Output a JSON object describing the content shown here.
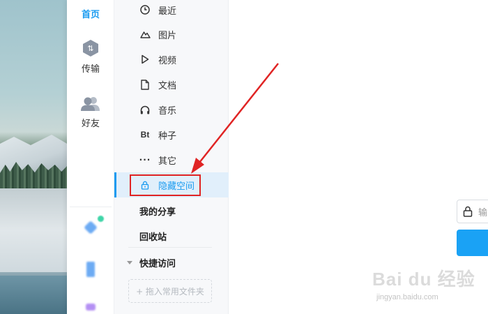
{
  "nav": {
    "home_label": "首页",
    "transfer_label": "传输",
    "friends_label": "好友",
    "transfer_icon_text": "⇅"
  },
  "categories": {
    "items": [
      {
        "label": "最近",
        "icon": "clock-icon"
      },
      {
        "label": "图片",
        "icon": "mountain-icon"
      },
      {
        "label": "视频",
        "icon": "play-icon"
      },
      {
        "label": "文档",
        "icon": "document-icon"
      },
      {
        "label": "音乐",
        "icon": "headphones-icon"
      },
      {
        "label": "种子",
        "icon": "bt-icon"
      },
      {
        "label": "其它",
        "icon": "dots-icon"
      },
      {
        "label": "隐藏空间",
        "icon": "lock-icon",
        "active": true
      }
    ],
    "bt_glyph": "Bt",
    "dots_glyph": "···",
    "my_share": "我的分享",
    "recycle_bin": "回收站",
    "quick_access": "快捷访问",
    "drop_zone": "+ 拖入常用文件夹"
  },
  "main": {
    "password_placeholder": "输"
  },
  "watermark": {
    "logo": "Bai du 经验",
    "url": "jingyan.baidu.com"
  },
  "colors": {
    "accent": "#1a9bf0",
    "active_bg": "#e1effb",
    "annotation_red": "#e02424",
    "button_blue": "#1aa2f5"
  }
}
